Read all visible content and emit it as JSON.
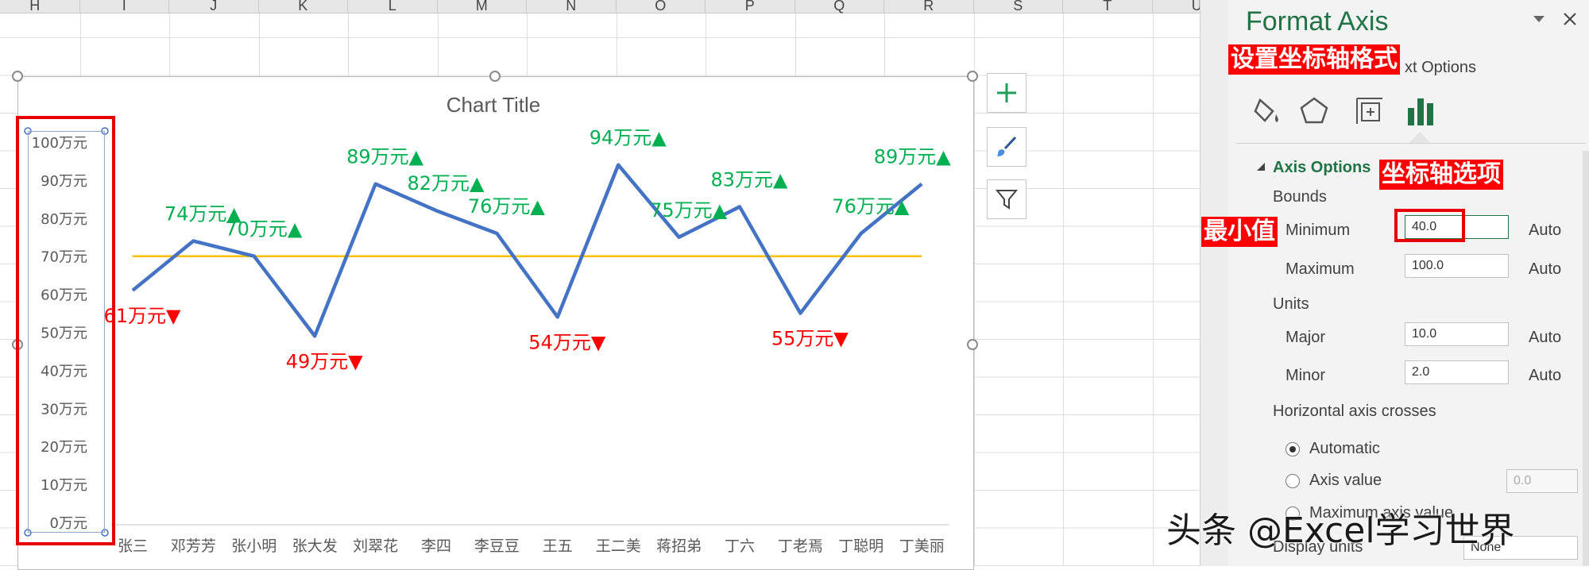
{
  "sheet": {
    "columns": [
      "H",
      "I",
      "J",
      "K",
      "L",
      "M",
      "N",
      "O",
      "P",
      "Q",
      "R",
      "S",
      "T",
      "U"
    ]
  },
  "chart": {
    "title": "Chart Title",
    "ref_line_value": 70,
    "colors": {
      "line": "#4472c4",
      "ref_line": "#ffc000",
      "up": "#00b050",
      "down": "#ff0000"
    }
  },
  "chart_data": {
    "type": "line",
    "title": "Chart Title",
    "categories": [
      "张三",
      "邓芳芳",
      "张小明",
      "张大发",
      "刘翠花",
      "李四",
      "李豆豆",
      "王五",
      "王二美",
      "蒋招弟",
      "丁六",
      "丁老焉",
      "丁聪明",
      "丁美丽"
    ],
    "series": [
      {
        "values": [
          61,
          74,
          70,
          49,
          89,
          82,
          76,
          54,
          94,
          75,
          83,
          55,
          76,
          89
        ]
      }
    ],
    "reference_line": 70,
    "ylim": [
      0,
      100
    ],
    "yticks": [
      "0万元",
      "10万元",
      "20万元",
      "30万元",
      "40万元",
      "50万元",
      "60万元",
      "70万元",
      "80万元",
      "90万元",
      "100万元"
    ],
    "data_labels": [
      "61万元▼",
      "74万元▲",
      "70万元▲",
      "49万元▼",
      "89万元▲",
      "82万元▲",
      "76万元▲",
      "54万元▼",
      "94万元▲",
      "75万元▲",
      "83万元▲",
      "55万元▼",
      "76万元▲",
      "89万元▲"
    ],
    "grid": false
  },
  "chart_tools": {
    "buttons": [
      "plus-icon",
      "brush-icon",
      "filter-icon"
    ]
  },
  "panel": {
    "title": "Format Axis",
    "tab_text_options": "xt Options",
    "tab_icons": [
      "paint-bucket-icon",
      "pentagon-icon",
      "size-properties-icon",
      "bar-chart-icon"
    ],
    "section_title": "Axis Options",
    "bounds_label": "Bounds",
    "minimum_label": "Minimum",
    "minimum_value": "40.0",
    "maximum_label": "Maximum",
    "maximum_value": "100.0",
    "units_label": "Units",
    "major_label": "Major",
    "major_value": "10.0",
    "minor_label": "Minor",
    "minor_value": "2.0",
    "auto_label": "Auto",
    "crosses_label": "Horizontal axis crosses",
    "automatic_label": "Automatic",
    "axis_value_label": "Axis value",
    "axis_value_input": "0.0",
    "maximum_axis_label": "Maximum axis value",
    "display_units_label": "Display units",
    "display_units_value": "None"
  },
  "annotations": {
    "set_axis_format": "设置坐标轴格式",
    "axis_options": "坐标轴选项",
    "min_value": "最小值"
  },
  "watermark": "头条 @Excel学习世界"
}
